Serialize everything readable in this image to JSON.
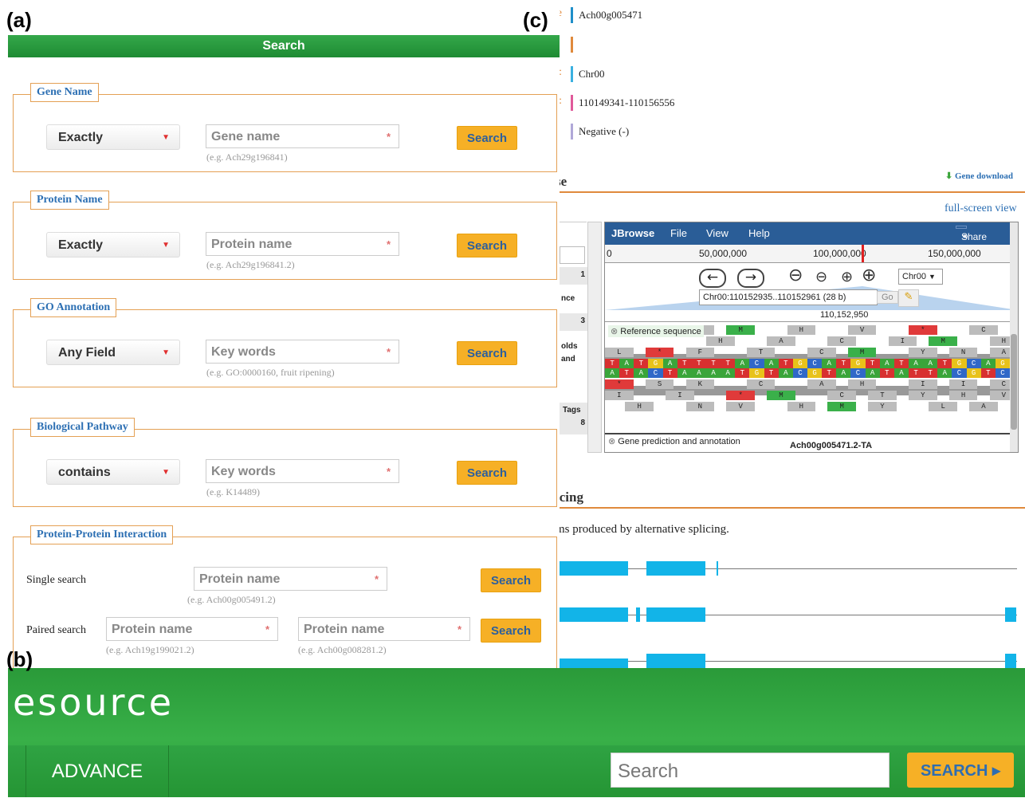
{
  "panel_labels": {
    "a": "(a)",
    "b": "(b)",
    "c": "(c)"
  },
  "panel_a": {
    "header": "Search",
    "sections": [
      {
        "legend": "Gene Name",
        "select": "Exactly",
        "placeholder": "Gene name",
        "hint": "(e.g. Ach29g196841)",
        "button": "Search"
      },
      {
        "legend": "Protein Name",
        "select": "Exactly",
        "placeholder": "Protein name",
        "hint": "(e.g. Ach29g196841.2)",
        "button": "Search"
      },
      {
        "legend": "GO Annotation",
        "select": "Any Field",
        "placeholder": "Key words",
        "hint": "(e.g. GO:0000160, fruit ripening)",
        "button": "Search"
      },
      {
        "legend": "Biological Pathway",
        "select": "contains",
        "placeholder": "Key words",
        "hint": "(e.g. K14489)",
        "button": "Search"
      }
    ],
    "ppi": {
      "legend": "Protein-Protein Interaction",
      "single_label": "Single search",
      "single_placeholder": "Protein name",
      "single_hint": "(e.g. Ach00g005491.2)",
      "paired_label": "Paired search",
      "paired_placeholder_1": "Protein name",
      "paired_hint_1": "(e.g. Ach19g199021.2)",
      "paired_placeholder_2": "Protein name",
      "paired_hint_2": "(e.g. Ach00g008281.2)",
      "button": "Search"
    },
    "required_mark": "*",
    "select_caret": "▼"
  },
  "panel_b": {
    "title": "esource",
    "nav_item": "ADVANCE",
    "search_placeholder": "Search",
    "search_button": "SEARCH ▸"
  },
  "panel_c": {
    "info": [
      {
        "key": "Gene name",
        "value": "Ach00g005471",
        "color": "#1f8fc9"
      },
      {
        "key": "",
        "value": "",
        "color": "#e08a3c"
      },
      {
        "key": ":",
        "value": "Chr00",
        "color": "#3ab0e0"
      },
      {
        "key": ":",
        "value": "110149341-110156556",
        "color": "#e05a9a"
      },
      {
        "key": "",
        "value": "Negative (-)",
        "color": "#b0a8d8"
      }
    ],
    "gene_download": "Gene download",
    "browse_title": "se",
    "full_screen": "full-screen view",
    "left_column": [
      "1",
      "nce",
      "3",
      "olds",
      "and",
      "Tags",
      "8"
    ],
    "jbrowse": {
      "menu": [
        "JBrowse",
        "File",
        "View",
        "Help"
      ],
      "share": "Share",
      "ruler": [
        "0",
        "50,000,000",
        "100,000,000",
        "150,000,000"
      ],
      "location": "Chr00:110152935..110152961 (28 b)",
      "go": "Go",
      "chromosome": "Chr00",
      "position": "110,152,950",
      "track1": "Reference sequence",
      "track2": "Gene prediction and annotation",
      "feature": "Ach00g005471.2-TA",
      "aa_rows": [
        [
          "",
          "",
          "",
          "",
          "Y",
          "",
          "M",
          "",
          "",
          "H",
          "",
          "",
          "V",
          "",
          "",
          "*",
          "",
          "",
          "C",
          ""
        ],
        [
          "",
          "",
          "",
          "",
          "",
          "H",
          "",
          "",
          "A",
          "",
          "",
          "C",
          "",
          "",
          "I",
          "",
          "M",
          "",
          "",
          "H"
        ],
        [
          "L",
          "",
          "*",
          "",
          "F",
          "",
          "",
          "T",
          "",
          "",
          "C",
          "",
          "M",
          "",
          "",
          "Y",
          "",
          "N",
          "",
          "A"
        ],
        [
          "",
          "",
          "",
          "",
          "",
          "",
          "",
          "",
          "",
          "",
          "",
          "",
          "",
          "",
          "",
          "",
          "",
          "",
          "",
          ""
        ],
        [
          "",
          "",
          "",
          "",
          "",
          "",
          "",
          "",
          "",
          "",
          "",
          "",
          "",
          "",
          "",
          "",
          "",
          "",
          "",
          ""
        ],
        [
          "*",
          "",
          "S",
          "",
          "K",
          "",
          "",
          "C",
          "",
          "",
          "A",
          "",
          "H",
          "",
          "",
          "I",
          "",
          "I",
          "",
          "C"
        ],
        [
          "I",
          "",
          "",
          "I",
          "",
          "",
          "*",
          "",
          "M",
          "",
          "",
          "C",
          "",
          "T",
          "",
          "Y",
          "",
          "H",
          "",
          "V"
        ],
        [
          "",
          "H",
          "",
          "",
          "N",
          "",
          "V",
          "",
          "",
          "H",
          "",
          "M",
          "",
          "Y",
          "",
          "",
          "L",
          "",
          "A",
          ""
        ]
      ],
      "dna_fwd": "TATGATTTTACATGCATGTATAATGCAG",
      "dna_rev": "ATACTAAAATGTACGTACATATTACGTC"
    },
    "splicing_title": "icing",
    "splicing_text": "ms produced by alternative splicing.",
    "colors": {
      "A": "#3aa53a",
      "T": "#d83030",
      "G": "#e8c21a",
      "C": "#3068c8",
      "accent": "#e08a3c"
    }
  }
}
